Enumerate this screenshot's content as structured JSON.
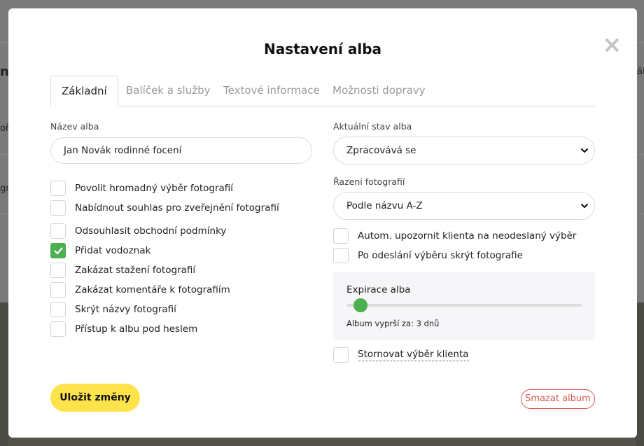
{
  "modal": {
    "title": "Nastavení alba",
    "close_icon": "close-icon"
  },
  "tabs": [
    {
      "label": "Základní",
      "active": true
    },
    {
      "label": "Balíček a služby",
      "active": false
    },
    {
      "label": "Textové informace",
      "active": false
    },
    {
      "label": "Možnosti dopravy",
      "active": false
    }
  ],
  "left": {
    "album_name_label": "Název alba",
    "album_name_value": "Jan Novák rodinné focení",
    "options": [
      {
        "label": "Povolit hromadný výběr fotografií",
        "checked": false
      },
      {
        "label": "Nabídnout souhlas pro zveřejnění fotografií",
        "checked": false
      },
      {
        "label": "Odsouhlasit obchodní podmínky",
        "checked": false
      },
      {
        "label": "Přidat vodoznak",
        "checked": true
      },
      {
        "label": "Zakázat stažení fotografií",
        "checked": false
      },
      {
        "label": "Zakázat komentáře k fotografiím",
        "checked": false
      },
      {
        "label": "Skrýt názvy fotografií",
        "checked": false
      },
      {
        "label": "Přístup k albu pod heslem",
        "checked": false
      }
    ]
  },
  "right": {
    "status_label": "Aktuální stav alba",
    "status_value": "Zpracovává se",
    "sort_label": "Řazení fotografií",
    "sort_value": "Podle názvu A-Z",
    "options": [
      {
        "label": "Autom. upozornit klienta na neodeslaný výběr",
        "checked": false
      },
      {
        "label": "Po odeslání výběru skrýt fotografie",
        "checked": false
      }
    ],
    "expiry": {
      "title": "Expirace alba",
      "text": "Album vyprší za: 3 dnů",
      "slider_fraction": 0.06
    },
    "cancel_selection_label": "Stornovat výběr klienta",
    "cancel_selection_checked": false
  },
  "footer": {
    "save_label": "Uložit změny",
    "delete_label": "Smazat album"
  },
  "colors": {
    "accent_green": "#4caf50",
    "save_yellow": "#ffe34d",
    "danger_red": "#d9534f"
  },
  "background_fragments": {
    "left_1": "n",
    "left_2": "oř",
    "left_3": "gr",
    "right_1": "ál"
  }
}
